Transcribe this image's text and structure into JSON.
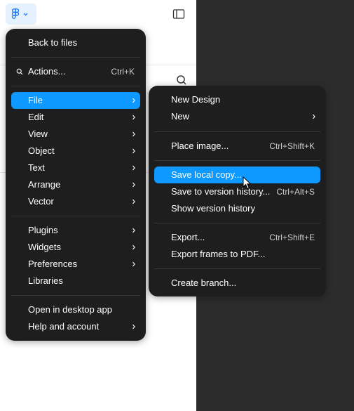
{
  "colors": {
    "accent": "#0d99ff",
    "menu_bg": "#1e1e1e",
    "canvas_bg": "#2c2c2c",
    "logo_bg": "#e5f1ff"
  },
  "toolbar": {
    "logo_icon": "figma-logo-icon",
    "panel_icon": "sidebar-toggle-icon",
    "search_icon": "search-icon"
  },
  "main_menu": {
    "back": "Back to files",
    "actions": {
      "label": "Actions...",
      "shortcut": "Ctrl+K"
    },
    "items": [
      {
        "label": "File",
        "highlighted": true
      },
      {
        "label": "Edit"
      },
      {
        "label": "View"
      },
      {
        "label": "Object"
      },
      {
        "label": "Text"
      },
      {
        "label": "Arrange"
      },
      {
        "label": "Vector"
      }
    ],
    "items2": [
      {
        "label": "Plugins"
      },
      {
        "label": "Widgets"
      },
      {
        "label": "Preferences"
      },
      {
        "label": "Libraries"
      }
    ],
    "items3": [
      {
        "label": "Open in desktop app"
      },
      {
        "label": "Help and account"
      }
    ]
  },
  "file_menu": {
    "new_design": "New Design",
    "new": "New",
    "place_image": {
      "label": "Place image...",
      "shortcut": "Ctrl+Shift+K"
    },
    "save_local": {
      "label": "Save local copy..."
    },
    "save_version": {
      "label": "Save to version history...",
      "shortcut": "Ctrl+Alt+S"
    },
    "show_version": "Show version history",
    "export": {
      "label": "Export...",
      "shortcut": "Ctrl+Shift+E"
    },
    "export_pdf": "Export frames to PDF...",
    "create_branch": "Create branch..."
  }
}
